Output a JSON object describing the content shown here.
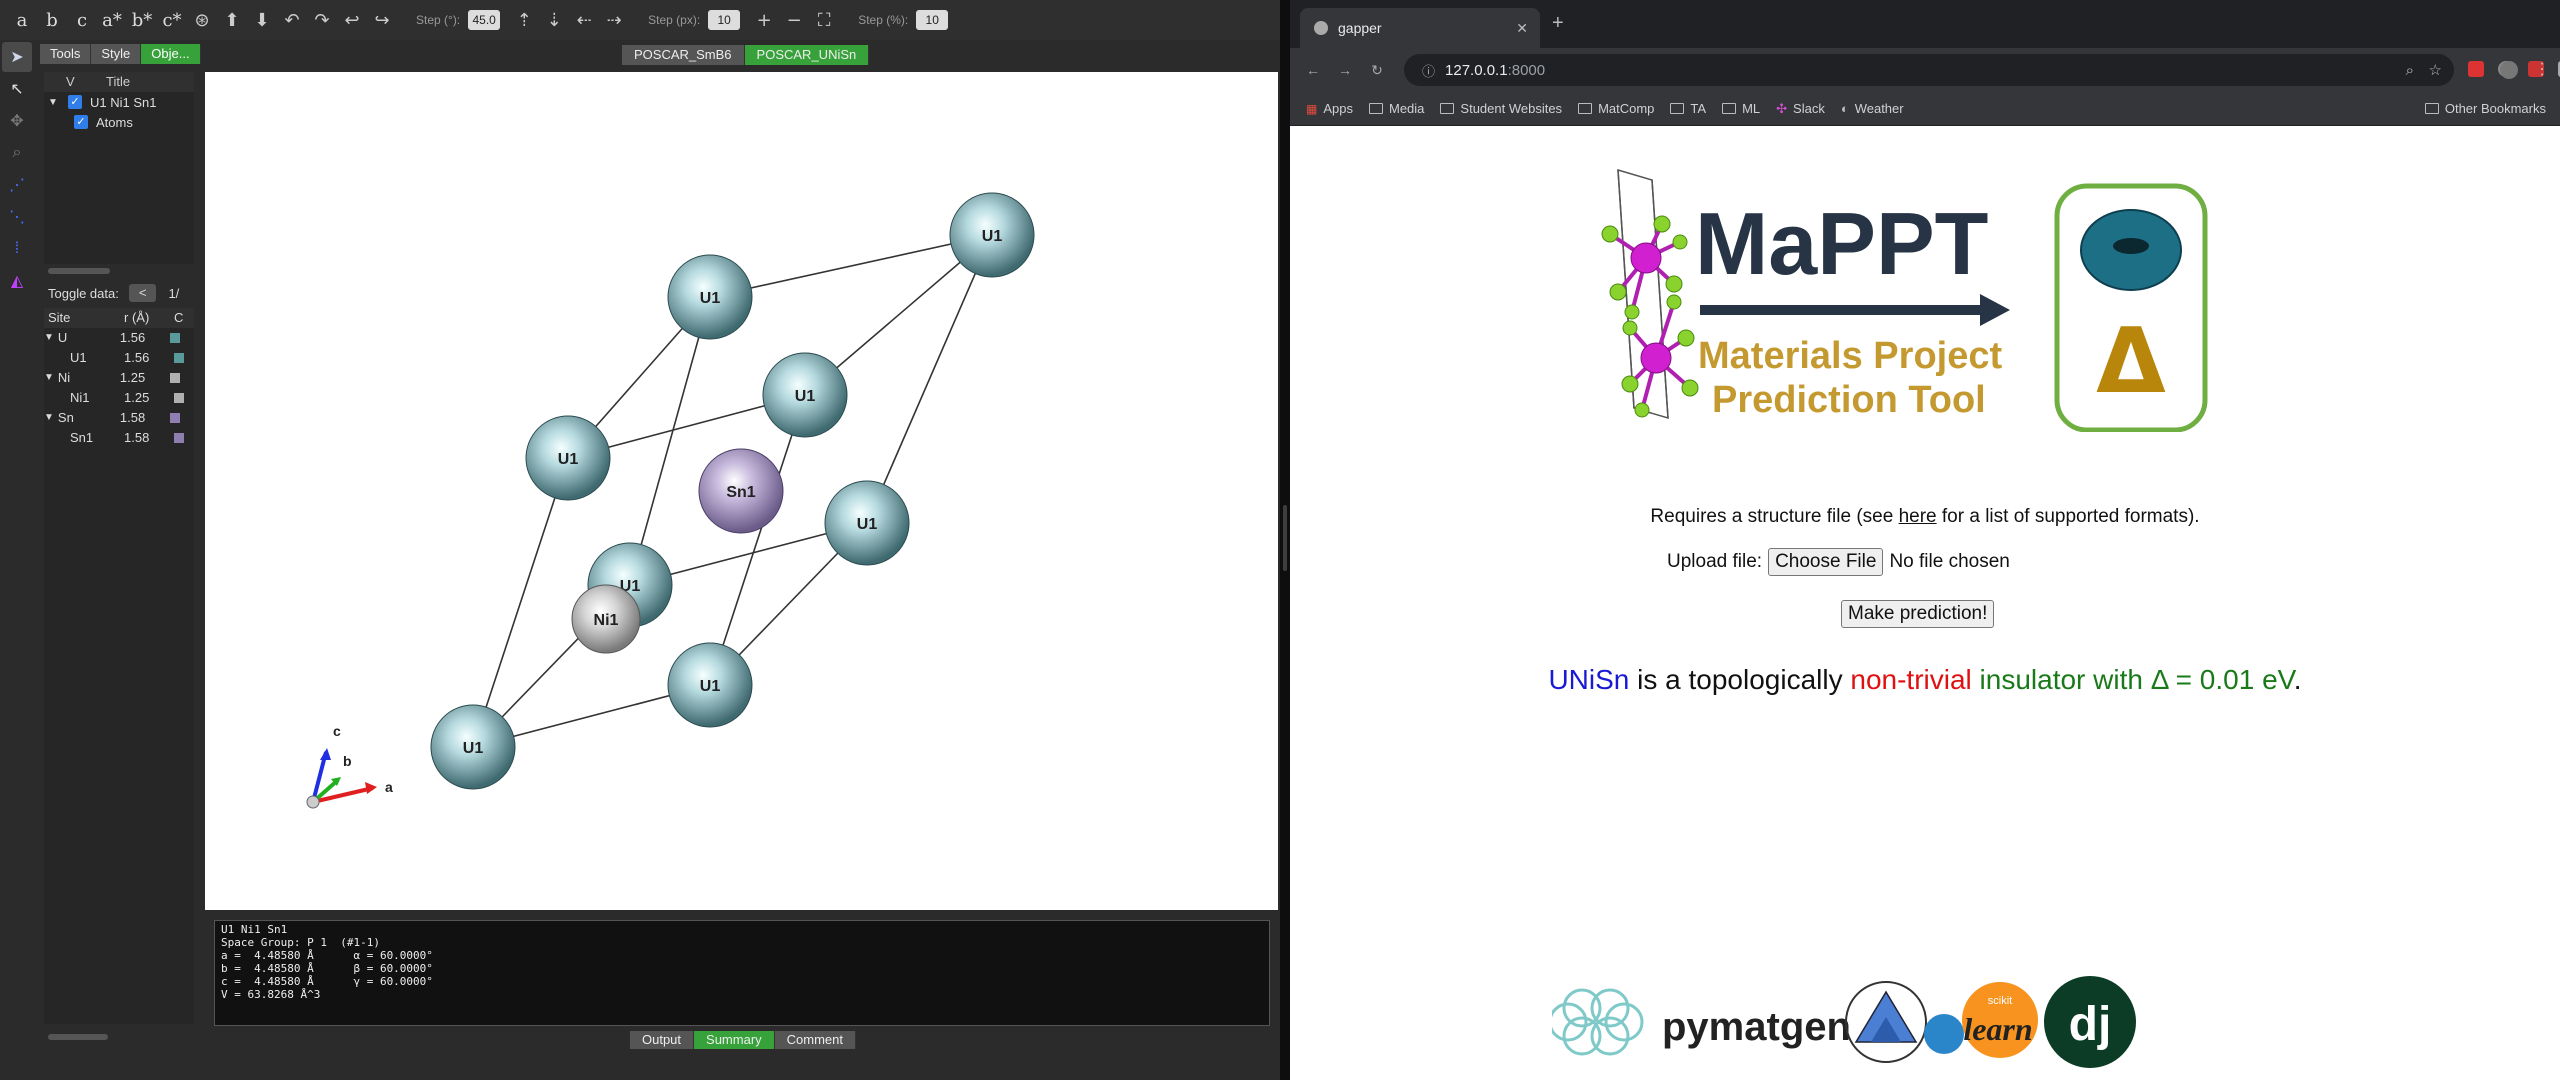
{
  "vesta": {
    "toolbar": {
      "step_deg_label": "Step (°):",
      "step_deg": "45.0",
      "step_px_label": "Step (px):",
      "step_px": "10",
      "step_pct_label": "Step (%):",
      "step_pct": "10"
    },
    "panel_tabs": [
      "Tools",
      "Style",
      "Obje..."
    ],
    "object_tree": {
      "col_v": "V",
      "col_title": "Title",
      "root": "U1 Ni1 Sn1",
      "child": "Atoms"
    },
    "toggle": {
      "label": "Toggle data:",
      "btn": "<",
      "page": "1/"
    },
    "site_table": {
      "headers": [
        "Site",
        "r (Å)",
        "C"
      ],
      "rows": [
        {
          "site": "U",
          "r": "1.56",
          "color": "#5a9a9a",
          "group": true
        },
        {
          "site": "U1",
          "r": "1.56",
          "color": "#5a9a9a",
          "group": false
        },
        {
          "site": "Ni",
          "r": "1.25",
          "color": "#b0b0b0",
          "group": true
        },
        {
          "site": "Ni1",
          "r": "1.25",
          "color": "#b0b0b0",
          "group": false
        },
        {
          "site": "Sn",
          "r": "1.58",
          "color": "#8f7fb0",
          "group": true
        },
        {
          "site": "Sn1",
          "r": "1.58",
          "color": "#8f7fb0",
          "group": false
        }
      ]
    },
    "file_tabs": [
      "POSCAR_SmB6",
      "POSCAR_UNiSn"
    ],
    "atoms": [
      "U1",
      "U1",
      "U1",
      "U1",
      "U1",
      "U1",
      "U1",
      "U1",
      "Sn1",
      "Ni1"
    ],
    "axes": {
      "a": "a",
      "b": "b",
      "c": "c"
    },
    "info": {
      "l1": "U1 Ni1 Sn1",
      "l2": "Space Group: P 1  (#1-1)",
      "l3": "a =  4.48580 Å      α = 60.0000°",
      "l4": "b =  4.48580 Å      β = 60.0000°",
      "l5": "c =  4.48580 Å      γ = 60.0000°",
      "l6": "V = 63.8268 Å^3"
    },
    "bottom_tabs": [
      "Output",
      "Summary",
      "Comment"
    ]
  },
  "browser": {
    "tab_title": "gapper",
    "url_host": "127.0.0.1",
    "url_port": ":8000",
    "bookmarks": [
      "Apps",
      "Media",
      "Student Websites",
      "MatComp",
      "TA",
      "ML",
      "Slack",
      "Weather"
    ],
    "other_bookmarks": "Other Bookmarks",
    "logo": {
      "title": "MaPPT",
      "line1": "Materials Project",
      "line2": "Prediction Tool",
      "delta": "Δ"
    },
    "req_pre": "Requires a structure file (see ",
    "req_link": "here",
    "req_post": " for a list of supported formats).",
    "upload_label": "Upload file:",
    "choose_btn": "Choose File",
    "no_file": "No file chosen",
    "predict_btn": "Make prediction!",
    "result": {
      "compound": "UNiSn",
      "mid": " is a topologically ",
      "class": "non-trivial",
      "end": " insulator with Δ = 0.01 eV",
      "dot": "."
    },
    "footer_logos": [
      "pymatgen",
      "scikit",
      "learn",
      "dj"
    ]
  }
}
